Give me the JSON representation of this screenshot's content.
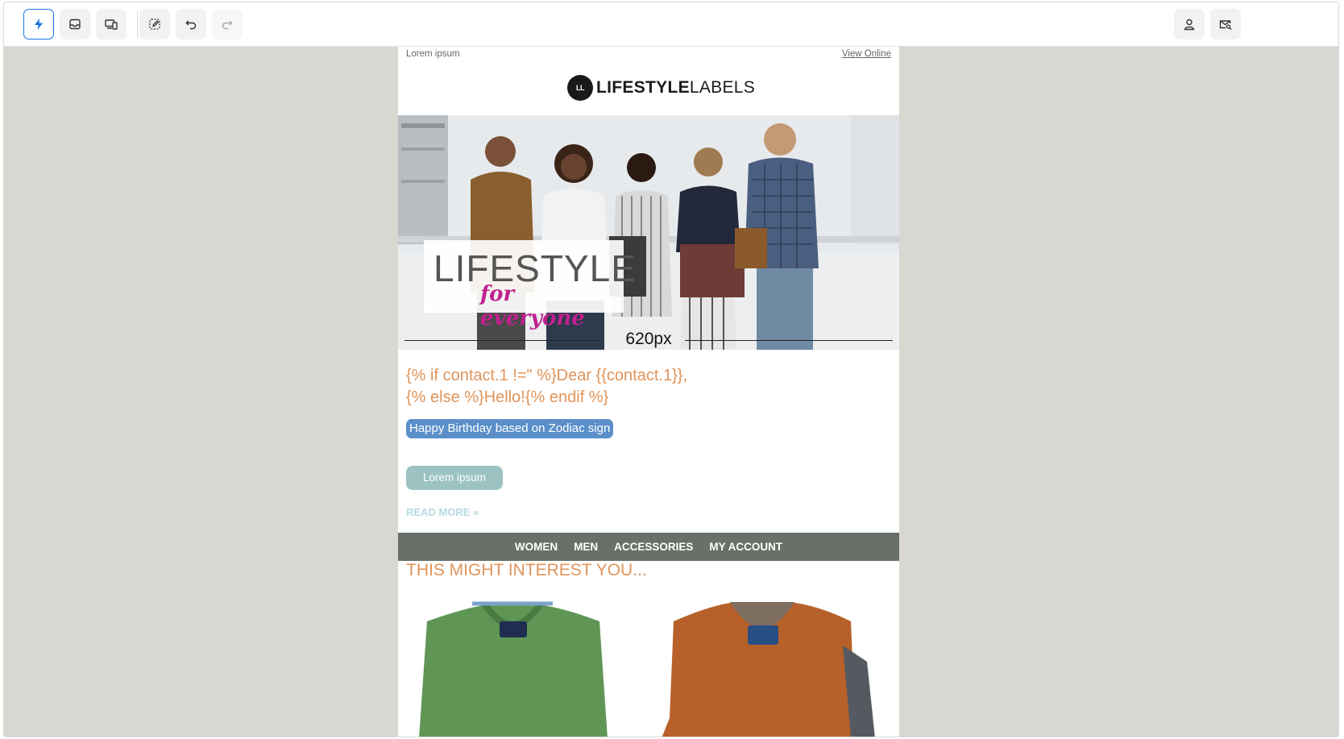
{
  "toolbar": {
    "left_buttons": [
      {
        "icon": "lightning-icon",
        "state": "active"
      },
      {
        "icon": "inbox-icon",
        "state": "normal"
      },
      {
        "icon": "devices-icon",
        "state": "normal"
      },
      {
        "icon": "edit-selection-icon",
        "state": "normal"
      },
      {
        "icon": "undo-icon",
        "state": "normal"
      },
      {
        "icon": "redo-icon",
        "state": "disabled"
      }
    ],
    "right_buttons": [
      {
        "icon": "user-icon"
      },
      {
        "icon": "mail-preview-icon"
      }
    ],
    "accent_color": "#1a73e8"
  },
  "email": {
    "preheader": "Lorem ipsum",
    "view_online": "View Online",
    "logo": {
      "badge": "LL",
      "bold": "LIFESTYLE",
      "light": "LABELS"
    },
    "hero": {
      "title": "LIFESTYLE",
      "subtitle": "for everyone",
      "width_label": "620px"
    },
    "greeting_line1": "{% if contact.1 !=\" %}Dear {{contact.1}},",
    "greeting_line2": "{% else %}Hello!{% endif %}",
    "tag_pill": "Happy Birthday based on Zodiac sign",
    "cta_button": "Lorem ipsum",
    "read_more": "READ MORE »",
    "nav": [
      "WOMEN",
      "MEN",
      "ACCESSORIES",
      "MY ACCOUNT"
    ],
    "interest_heading": "THIS MIGHT INTEREST YOU...",
    "products": [
      {
        "name": "green-sweater",
        "color": "#5f9655"
      },
      {
        "name": "orange-sweater",
        "color": "#b8602a"
      }
    ]
  },
  "colors": {
    "canvas_bg": "#d9d7d1",
    "heading_orange": "#e0945a",
    "tag_blue": "#5b8fc9",
    "cta_teal": "#9cc3c2",
    "nav_bg": "#687068"
  }
}
